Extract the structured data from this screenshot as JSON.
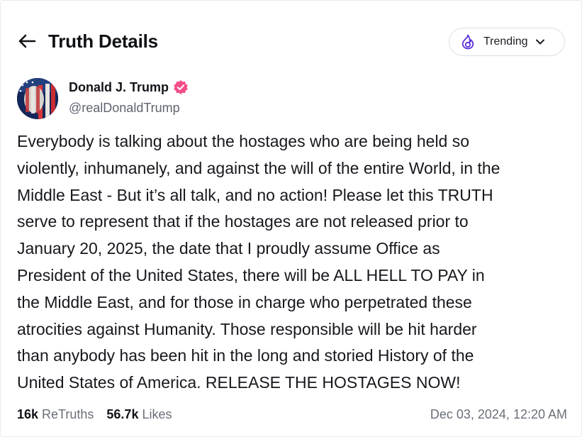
{
  "header": {
    "title": "Truth Details",
    "back_icon": "arrow-left-icon"
  },
  "trending": {
    "label": "Trending",
    "icon": "flame-icon",
    "chevron": "chevron-down-icon",
    "accent": "#5a2fd6"
  },
  "post": {
    "author": {
      "display_name": "Donald J. Trump",
      "handle": "@realDonaldTrump",
      "verified": true,
      "verified_color": "#f24d8a"
    },
    "text_lines": [
      "Everybody is talking about the hostages who are being held so",
      "violently, inhumanely, and against the will of the entire World, in the",
      "Middle East - But it’s all talk, and no action! Please let this TRUTH",
      "serve to represent that if the hostages are not released prior to",
      "January 20, 2025, the date that I proudly assume Office as",
      "President of the United States, there will be ALL HELL TO PAY in",
      "the Middle East, and for those in charge who perpetrated these",
      "atrocities against Humanity. Those responsible will be hit harder",
      "than anybody has been hit in the long and storied History of the",
      "United States of America. RELEASE THE HOSTAGES NOW!"
    ],
    "stats": {
      "retruths_count": "16k",
      "retruths_label": "ReTruths",
      "likes_count": "56.7k",
      "likes_label": "Likes"
    },
    "timestamp": "Dec 03, 2024, 12:20 AM"
  }
}
